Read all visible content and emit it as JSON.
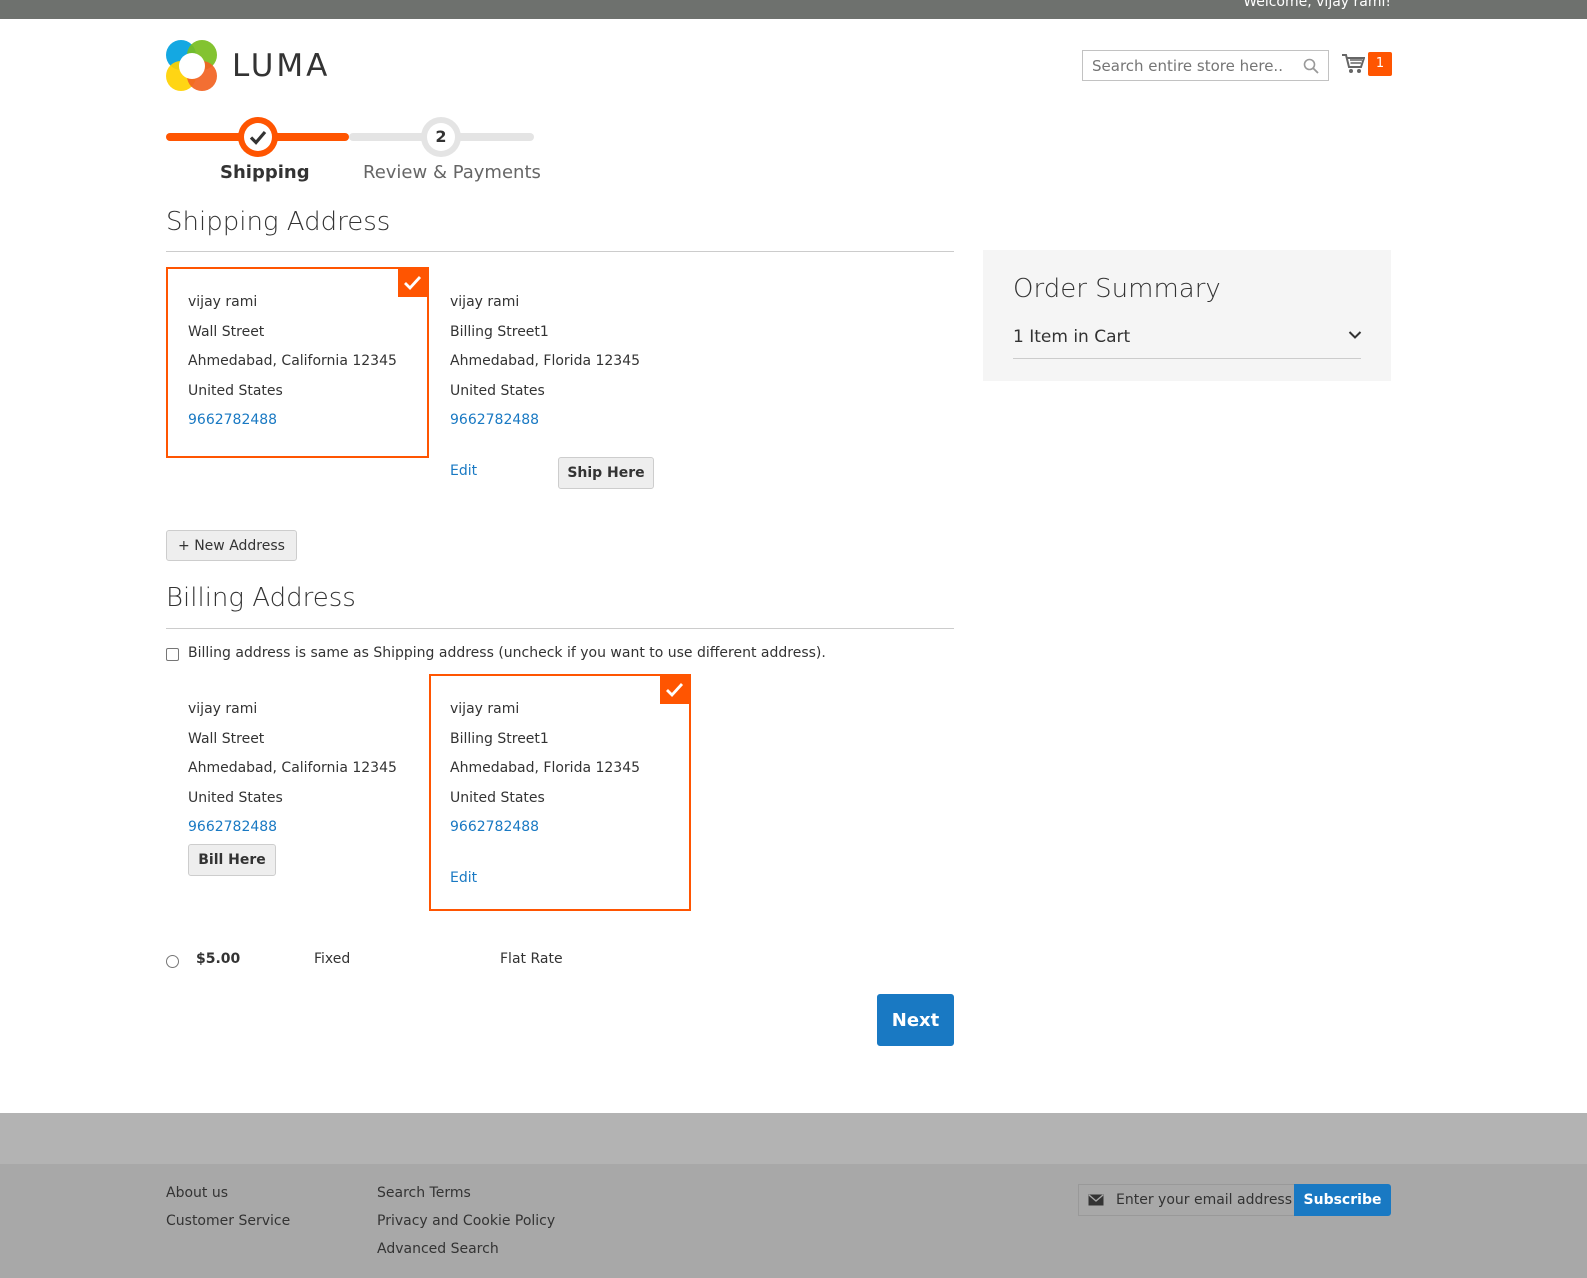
{
  "header": {
    "welcome": "Welcome, vijay rami!",
    "logo_text": "LUMA",
    "search_placeholder": "Search entire store here...",
    "cart_count": "1"
  },
  "progress": {
    "steps": [
      {
        "number": "",
        "label": "Shipping",
        "state": "complete"
      },
      {
        "number": "2",
        "label": "Review & Payments",
        "state": "pending"
      }
    ]
  },
  "shipping": {
    "title": "Shipping Address",
    "addresses": [
      {
        "name": "vijay rami",
        "street": "Wall Street",
        "city": "Ahmedabad, California 12345",
        "country": "United States",
        "phone": "9662782488",
        "selected": true
      },
      {
        "name": "vijay rami",
        "street": "Billing Street1",
        "city": "Ahmedabad, Florida 12345",
        "country": "United States",
        "phone": "9662782488",
        "selected": false,
        "edit_label": "Edit",
        "action_label": "Ship Here"
      }
    ],
    "new_address_label": "+ New Address"
  },
  "billing": {
    "title": "Billing Address",
    "same_as_shipping_label": "Billing address is same as Shipping address (uncheck if you want to use different address).",
    "same_as_shipping_checked": false,
    "addresses": [
      {
        "name": "vijay rami",
        "street": "Wall Street",
        "city": "Ahmedabad, California 12345",
        "country": "United States",
        "phone": "9662782488",
        "selected": false,
        "action_label": "Bill Here"
      },
      {
        "name": "vijay rami",
        "street": "Billing Street1",
        "city": "Ahmedabad, Florida 12345",
        "country": "United States",
        "phone": "9662782488",
        "selected": true,
        "edit_label": "Edit"
      }
    ]
  },
  "shipping_method": {
    "price": "$5.00",
    "method": "Fixed",
    "carrier": "Flat Rate",
    "selected": false
  },
  "next_label": "Next",
  "order_summary": {
    "title": "Order Summary",
    "items_label": "1 Item in Cart"
  },
  "footer": {
    "col1": [
      "About us",
      "Customer Service"
    ],
    "col2": [
      "Search Terms",
      "Privacy and Cookie Policy",
      "Advanced Search"
    ],
    "newsletter_placeholder": "Enter your email address",
    "subscribe_label": "Subscribe"
  },
  "colors": {
    "accent": "#ff5501",
    "link": "#1979c3",
    "primary_button": "#1979c3"
  }
}
